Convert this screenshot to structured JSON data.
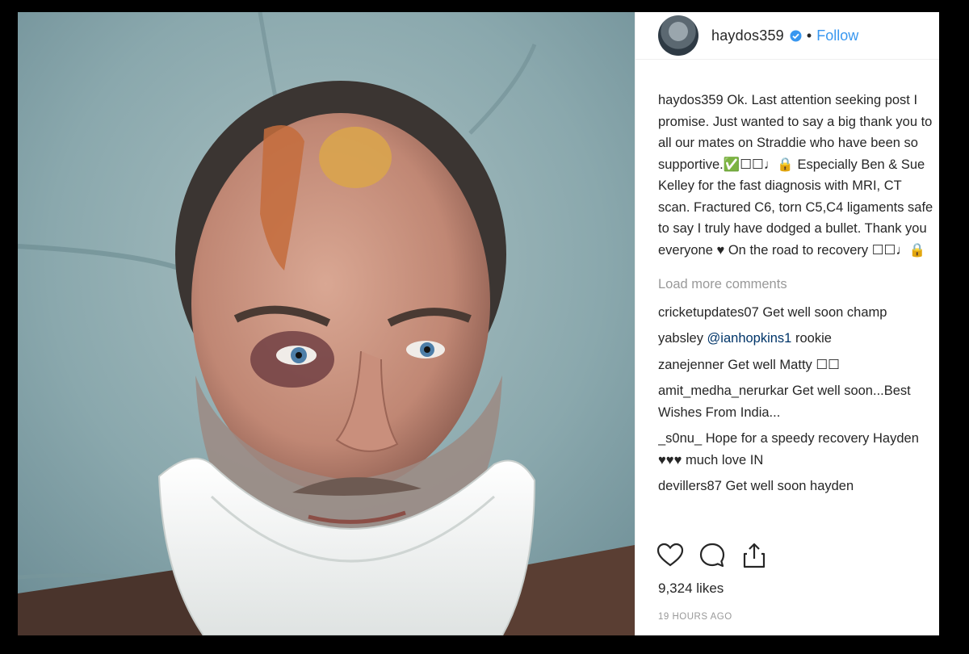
{
  "post": {
    "username": "haydos359",
    "verified": true,
    "separator": "•",
    "follow_label": "Follow",
    "caption": {
      "username": "haydos359",
      "text": "Ok. Last attention seeking post I promise. Just wanted to say a big thank you to all our mates on Straddie who have been so supportive.✅☐☐♩🔒 Especially Ben & Sue Kelley for the fast diagnosis with MRI, CT scan. Fractured C6, torn C5,C4 ligaments safe to say I truly have dodged a bullet. Thank you everyone ♥ On the road to recovery ☐☐♩🔒"
    },
    "load_more_label": "Load more comments",
    "comments": [
      {
        "username": "cricketupdates07",
        "mention": "",
        "text": "Get well soon champ"
      },
      {
        "username": "yabsley",
        "mention": "@ianhopkins1",
        "text": "rookie"
      },
      {
        "username": "zanejenner",
        "mention": "",
        "text": "Get well Matty ☐☐"
      },
      {
        "username": "amit_medha_nerurkar",
        "mention": "",
        "text": "Get well soon...Best Wishes From India..."
      },
      {
        "username": "_s0nu_",
        "mention": "",
        "text": "Hope for a speedy recovery Hayden ♥♥♥ much love IN"
      },
      {
        "username": "devillers87",
        "mention": "",
        "text": "Get well soon hayden"
      }
    ],
    "actions": {
      "like_icon": "heart-outline-icon",
      "comment_icon": "speech-bubble-icon",
      "share_icon": "share-upload-icon"
    },
    "likes": "9,324 likes",
    "timestamp": "19 HOURS AGO"
  },
  "colors": {
    "link_blue": "#3897f0",
    "mention_blue": "#003569",
    "muted_gray": "#999999",
    "text": "#262626",
    "frame": "#000000"
  }
}
